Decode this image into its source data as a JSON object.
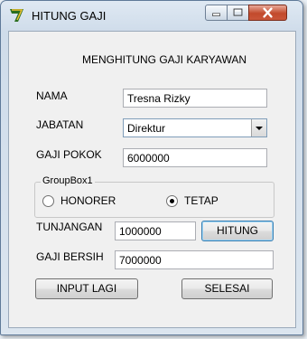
{
  "window": {
    "title": "HITUNG GAJI"
  },
  "form": {
    "heading": "MENGHITUNG GAJI KARYAWAN",
    "nama": {
      "label": "NAMA",
      "value": "Tresna Rizky"
    },
    "jabatan": {
      "label": "JABATAN",
      "selected": "Direktur"
    },
    "gaji_pokok": {
      "label": "GAJI POKOK",
      "value": "6000000"
    },
    "groupbox": {
      "title": "GroupBox1",
      "options": [
        {
          "label": "HONORER",
          "checked": false
        },
        {
          "label": "TETAP",
          "checked": true
        }
      ]
    },
    "tunjangan": {
      "label": "TUNJANGAN",
      "value": "1000000"
    },
    "hitung_label": "HITUNG",
    "gaji_bersih": {
      "label": "GAJI BERSIH",
      "value": "7000000"
    },
    "input_lagi_label": "INPUT LAGI",
    "selesai_label": "SELESAI"
  },
  "colors": {
    "close_button": "#c24a2c",
    "focus_border": "#3c7fb1"
  }
}
